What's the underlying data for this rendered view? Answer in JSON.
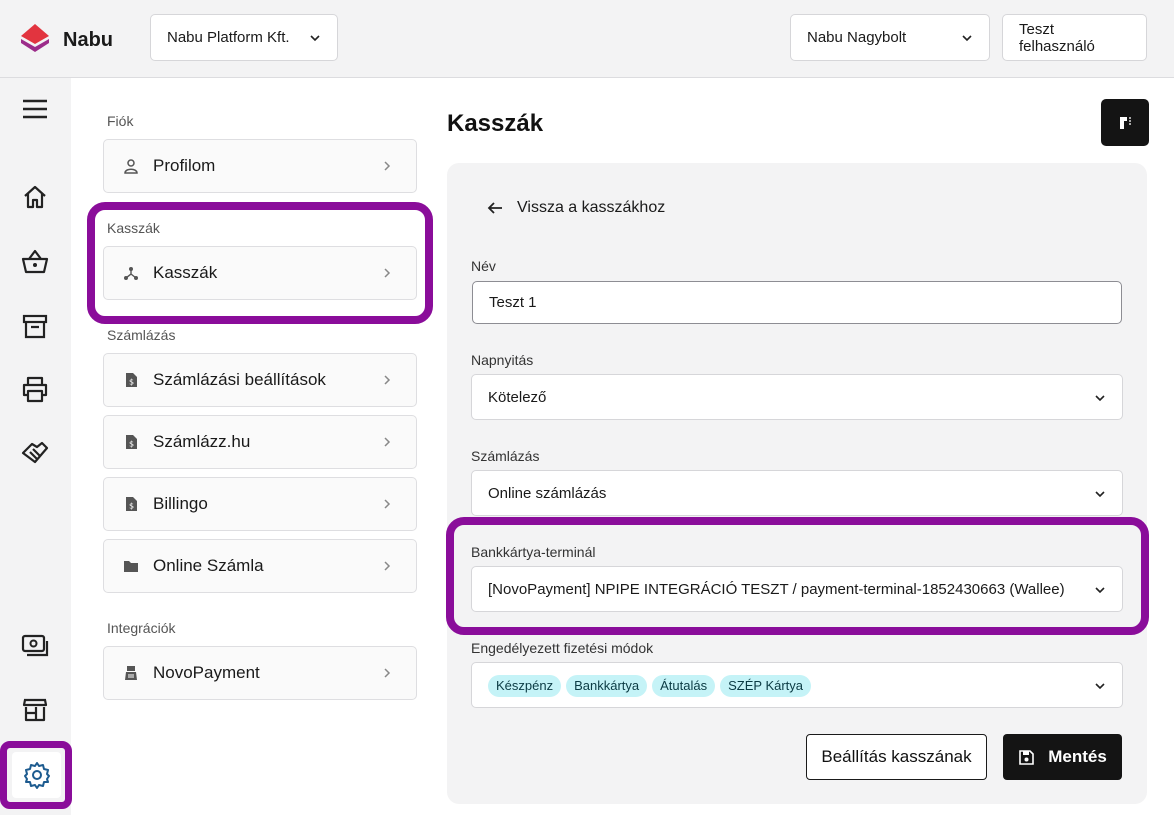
{
  "header": {
    "app_name": "Nabu",
    "company_select": "Nabu Platform Kft.",
    "store_select": "Nabu Nagybolt",
    "user_button": "Teszt felhasználó",
    "brand_colors": {
      "logo_top": "#e2343f",
      "logo_bottom": "#9c2c8a"
    }
  },
  "rail": {
    "items": [
      "menu-icon",
      "home-icon",
      "basket-icon",
      "archive-icon",
      "printer-icon",
      "handshake-icon",
      "cash-icon",
      "store-icon",
      "settings-icon"
    ],
    "active": "settings-icon"
  },
  "settings_nav": {
    "sections": [
      {
        "label": "Fiók",
        "items": [
          {
            "label": "Profilom",
            "icon": "user-icon"
          }
        ]
      },
      {
        "label": "Kasszák",
        "items": [
          {
            "label": "Kasszák",
            "icon": "fork-icon"
          }
        ]
      },
      {
        "label": "Számlázás",
        "items": [
          {
            "label": "Számlázási beállítások",
            "icon": "invoice-icon"
          },
          {
            "label": "Számlázz.hu",
            "icon": "invoice-icon"
          },
          {
            "label": "Billingo",
            "icon": "invoice-icon"
          },
          {
            "label": "Online Számla",
            "icon": "folder-icon"
          }
        ]
      },
      {
        "label": "Integrációk",
        "items": [
          {
            "label": "NovoPayment",
            "icon": "terminal-icon"
          }
        ]
      }
    ]
  },
  "main": {
    "title": "Kasszák",
    "back_link": "Vissza a kasszákhoz",
    "form": {
      "name_label": "Név",
      "name_value": "Teszt 1",
      "day_open_label": "Napnyitás",
      "day_open_value": "Kötelező",
      "billing_label": "Számlázás",
      "billing_value": "Online számlázás",
      "terminal_label": "Bankkártya-terminál",
      "terminal_value": "[NovoPayment] NPIPE INTEGRÁCIÓ TESZT / payment-terminal-1852430663 (Wallee)",
      "payment_methods_label": "Engedélyezett fizetési módok",
      "payment_methods": [
        "Készpénz",
        "Bankkártya",
        "Átutalás",
        "SZÉP Kártya"
      ]
    },
    "buttons": {
      "secondary": "Beállítás kasszának",
      "primary": "Mentés"
    }
  },
  "colors": {
    "highlight": "#8a0d9a",
    "chip_bg": "#c5f3f7",
    "accent_icon": "#1d5b8f"
  }
}
